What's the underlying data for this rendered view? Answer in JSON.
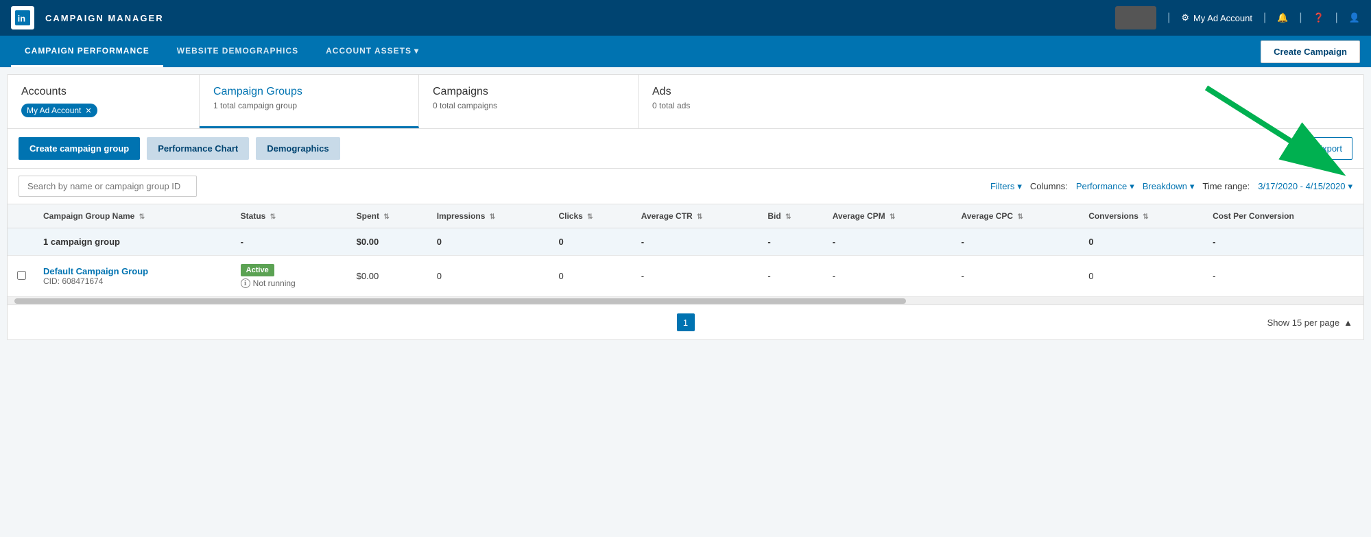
{
  "app": {
    "logo_aria": "LinkedIn",
    "title": "CAMPAIGN MANAGER"
  },
  "topnav": {
    "account_name": "My Ad Account",
    "settings_label": "My Ad Account",
    "bell_icon": "bell",
    "help_icon": "question-circle",
    "avatar_icon": "user-avatar"
  },
  "subnav": {
    "items": [
      {
        "id": "campaign-performance",
        "label": "CAMPAIGN PERFORMANCE",
        "active": true
      },
      {
        "id": "website-demographics",
        "label": "WEBSITE DEMOGRAPHICS",
        "active": false
      },
      {
        "id": "account-assets",
        "label": "ACCOUNT ASSETS",
        "active": false,
        "has_dropdown": true
      }
    ],
    "create_campaign_label": "Create Campaign"
  },
  "breadcrumb": {
    "panels": [
      {
        "id": "accounts",
        "title": "Accounts",
        "subtitle": "",
        "has_badge": true,
        "badge_text": "My Ad Account",
        "active": false
      },
      {
        "id": "campaign-groups",
        "title": "Campaign Groups",
        "subtitle": "1 total campaign group",
        "active": true
      },
      {
        "id": "campaigns",
        "title": "Campaigns",
        "subtitle": "0 total campaigns",
        "active": false
      },
      {
        "id": "ads",
        "title": "Ads",
        "subtitle": "0 total ads",
        "active": false
      }
    ]
  },
  "toolbar": {
    "create_group_label": "Create campaign group",
    "perf_chart_label": "Performance Chart",
    "demographics_label": "Demographics",
    "export_label": "Export"
  },
  "filters": {
    "search_placeholder": "Search by name or campaign group ID",
    "filters_label": "Filters",
    "columns_label": "Columns:",
    "columns_value": "Performance",
    "breakdown_label": "Breakdown",
    "time_range_label": "Time range:",
    "time_range_value": "3/17/2020 - 4/15/2020"
  },
  "table": {
    "columns": [
      {
        "id": "name",
        "label": "Campaign Group Name"
      },
      {
        "id": "status",
        "label": "Status"
      },
      {
        "id": "spent",
        "label": "Spent"
      },
      {
        "id": "impressions",
        "label": "Impressions"
      },
      {
        "id": "clicks",
        "label": "Clicks"
      },
      {
        "id": "avg_ctr",
        "label": "Average CTR"
      },
      {
        "id": "bid",
        "label": "Bid"
      },
      {
        "id": "avg_cpm",
        "label": "Average CPM"
      },
      {
        "id": "avg_cpc",
        "label": "Average CPC"
      },
      {
        "id": "conversions",
        "label": "Conversions"
      },
      {
        "id": "cost_per_conversion",
        "label": "Cost Per Conversion"
      }
    ],
    "group_row": {
      "name": "1 campaign group",
      "status": "-",
      "spent": "$0.00",
      "impressions": "0",
      "clicks": "0",
      "avg_ctr": "-",
      "bid": "-",
      "avg_cpm": "-",
      "avg_cpc": "-",
      "conversions": "0",
      "cost_per_conversion": "-"
    },
    "rows": [
      {
        "id": "default-campaign-group",
        "name": "Default Campaign Group",
        "cid": "CID: 608471674",
        "status_badge": "Active",
        "not_running": "Not running",
        "spent": "$0.00",
        "impressions": "0",
        "clicks": "0",
        "avg_ctr": "-",
        "bid": "-",
        "avg_cpm": "-",
        "avg_cpc": "-",
        "conversions": "0",
        "cost_per_conversion": "-"
      }
    ]
  },
  "pagination": {
    "current_page": "1",
    "show_per_page": "Show 15 per page"
  },
  "colors": {
    "primary": "#0073b1",
    "dark_nav": "#004471",
    "mid_nav": "#0073b1",
    "active_green": "#5ba253",
    "accent": "#00a0dc"
  }
}
